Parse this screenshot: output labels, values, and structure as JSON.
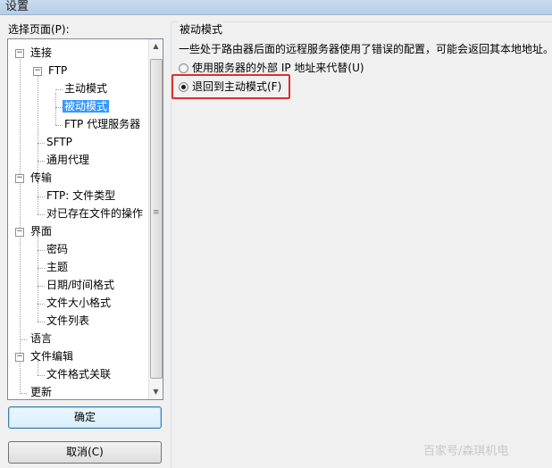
{
  "window": {
    "title": "设置"
  },
  "tree_section": {
    "label": "选择页面(P):",
    "items": [
      {
        "id": "connection",
        "label": "连接",
        "expander": "−"
      },
      {
        "id": "ftp",
        "label": "FTP",
        "expander": "−"
      },
      {
        "id": "active",
        "label": "主动模式"
      },
      {
        "id": "passive",
        "label": "被动模式",
        "selected": true
      },
      {
        "id": "ftp-proxy",
        "label": "FTP 代理服务器"
      },
      {
        "id": "sftp",
        "label": "SFTP"
      },
      {
        "id": "generic-proxy",
        "label": "通用代理"
      },
      {
        "id": "transfers",
        "label": "传输",
        "expander": "−"
      },
      {
        "id": "ftp-file-types",
        "label": "FTP: 文件类型"
      },
      {
        "id": "existing-files",
        "label": "对已存在文件的操作"
      },
      {
        "id": "interface",
        "label": "界面",
        "expander": "−"
      },
      {
        "id": "passwords",
        "label": "密码"
      },
      {
        "id": "themes",
        "label": "主题"
      },
      {
        "id": "datetime-format",
        "label": "日期/时间格式"
      },
      {
        "id": "filesize-format",
        "label": "文件大小格式"
      },
      {
        "id": "file-lists",
        "label": "文件列表"
      },
      {
        "id": "language",
        "label": "语言"
      },
      {
        "id": "file-editing",
        "label": "文件编辑",
        "expander": "−"
      },
      {
        "id": "file-assoc",
        "label": "文件格式关联"
      },
      {
        "id": "updates",
        "label": "更新"
      }
    ]
  },
  "buttons": {
    "ok": "确定",
    "cancel": "取消(C)"
  },
  "panel": {
    "group_title": "被动模式",
    "description": "一些处于路由器后面的远程服务器使用了错误的配置，可能会返回其本地地址。",
    "options": [
      {
        "label": "使用服务器的外部 IP 地址来代替(U)",
        "checked": false
      },
      {
        "label": "退回到主动模式(F)",
        "checked": true
      }
    ]
  },
  "watermark": "百家号/森琪机电",
  "colors": {
    "selection": "#3399ff",
    "highlight_box": "#d9312b"
  }
}
